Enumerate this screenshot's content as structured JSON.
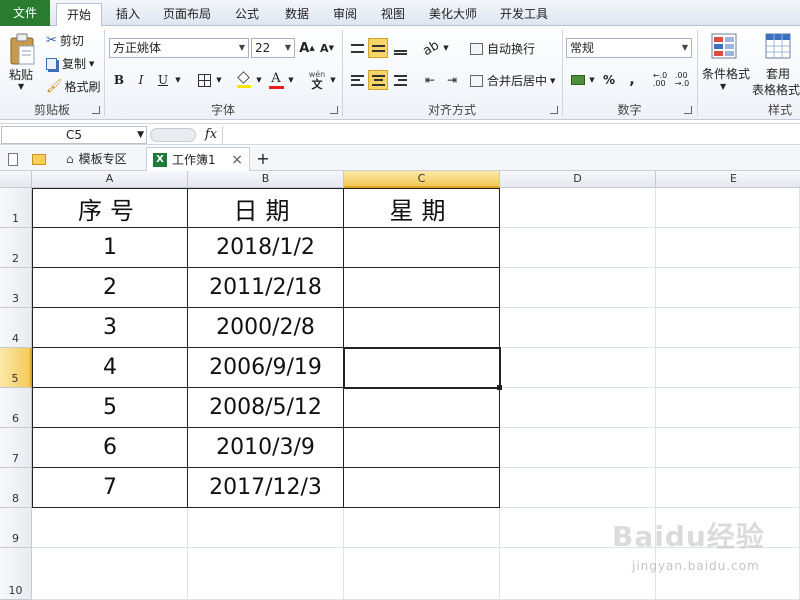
{
  "menu": {
    "tabs": [
      "文件",
      "开始",
      "插入",
      "页面布局",
      "公式",
      "数据",
      "审阅",
      "视图",
      "美化大师",
      "开发工具"
    ],
    "active": "开始"
  },
  "ribbon": {
    "clipboard": {
      "label": "剪贴板",
      "paste": "粘贴",
      "cut": "剪切",
      "copy": "复制",
      "format_painter": "格式刷"
    },
    "font": {
      "label": "字体",
      "name": "方正姚体",
      "size": "22",
      "grow": "A",
      "shrink": "A",
      "bold": "B",
      "italic": "I",
      "underline": "U",
      "font_color_letter": "A",
      "wen": "wén"
    },
    "alignment": {
      "label": "对齐方式",
      "wrap_text": "自动换行",
      "merge_center": "合并后居中"
    },
    "number": {
      "label": "数字",
      "format": "常规",
      "percent": "%",
      "comma": ","
    },
    "styles": {
      "label": "样式",
      "conditional": "条件格式",
      "table_format_1": "套用",
      "table_format_2": "表格格式"
    }
  },
  "formula_bar": {
    "name_box": "C5",
    "fx": "fx",
    "content": ""
  },
  "doc_tabs": {
    "template": "模板专区",
    "workbook": "工作簿1",
    "close": "×",
    "add": "+"
  },
  "sheet": {
    "columns": [
      "A",
      "B",
      "C",
      "D",
      "E"
    ],
    "rows": [
      "1",
      "2",
      "3",
      "4",
      "5",
      "6",
      "7",
      "8",
      "9",
      "10"
    ],
    "selected_cell": "C5",
    "headers": [
      "序号",
      "日期",
      "星期"
    ],
    "data": [
      [
        "1",
        "2018/1/2",
        ""
      ],
      [
        "2",
        "2011/2/18",
        ""
      ],
      [
        "3",
        "2000/2/8",
        ""
      ],
      [
        "4",
        "2006/9/19",
        ""
      ],
      [
        "5",
        "2008/5/12",
        ""
      ],
      [
        "6",
        "2010/3/9",
        ""
      ],
      [
        "7",
        "2017/12/3",
        ""
      ]
    ]
  },
  "watermark": {
    "brand": "Baidu经验",
    "url": "jingyan.baidu.com"
  },
  "colors": {
    "file_tab": "#2a7b30",
    "selection_header": "#f4c95a",
    "highlight": "#f8d46b"
  }
}
